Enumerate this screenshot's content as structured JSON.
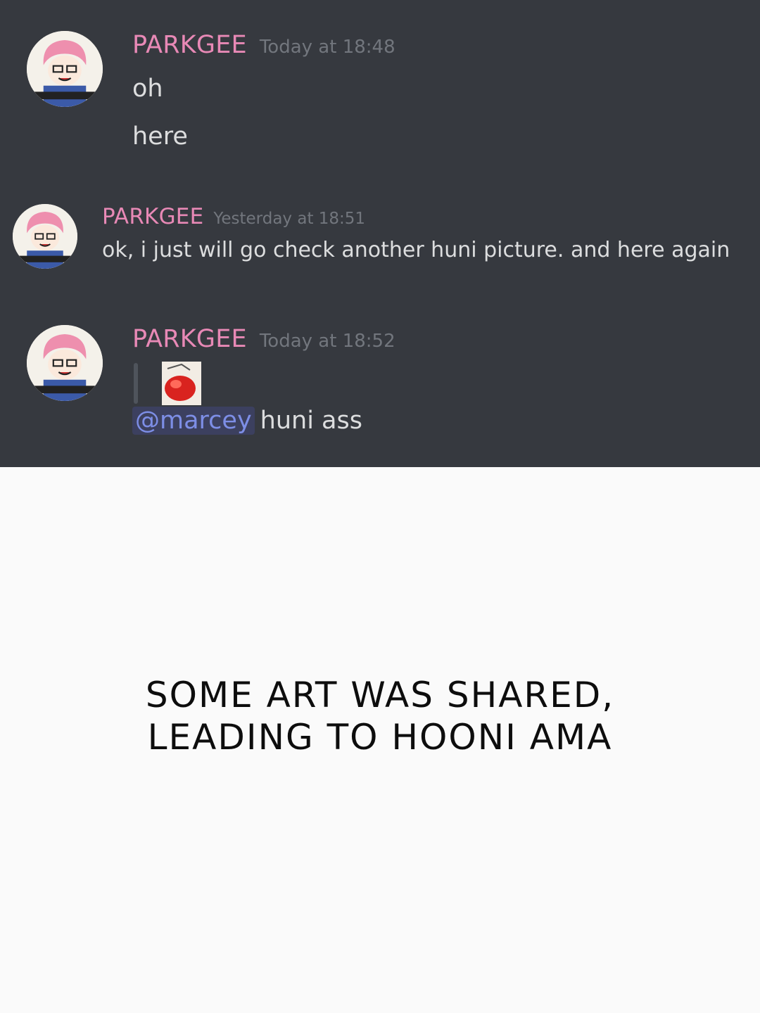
{
  "messages": [
    {
      "username": "PARKGEE",
      "timestamp": "Today at 18:48",
      "lines": [
        "oh",
        "here"
      ]
    },
    {
      "username": "PARKGEE",
      "timestamp": "Yesterday at 18:51",
      "lines": [
        "ok, i just will go check another huni picture. and here again"
      ]
    },
    {
      "username": "PARKGEE",
      "timestamp": "Today at 18:52",
      "mention": "@marcey",
      "text": "huni ass"
    }
  ],
  "caption": {
    "line1": "SOME ART WAS SHARED,",
    "line2": "LEADING TO HOONI AMA"
  },
  "colors": {
    "background_chat": "#36393f",
    "username": "#e889b6",
    "timestamp": "#72767d",
    "message_text": "#dcddde",
    "mention": "#7d8ee6",
    "background_bottom": "#fafafa"
  },
  "icons": {
    "avatar": "avatar-icon",
    "reply_thumbnail": "image-thumbnail-icon"
  }
}
